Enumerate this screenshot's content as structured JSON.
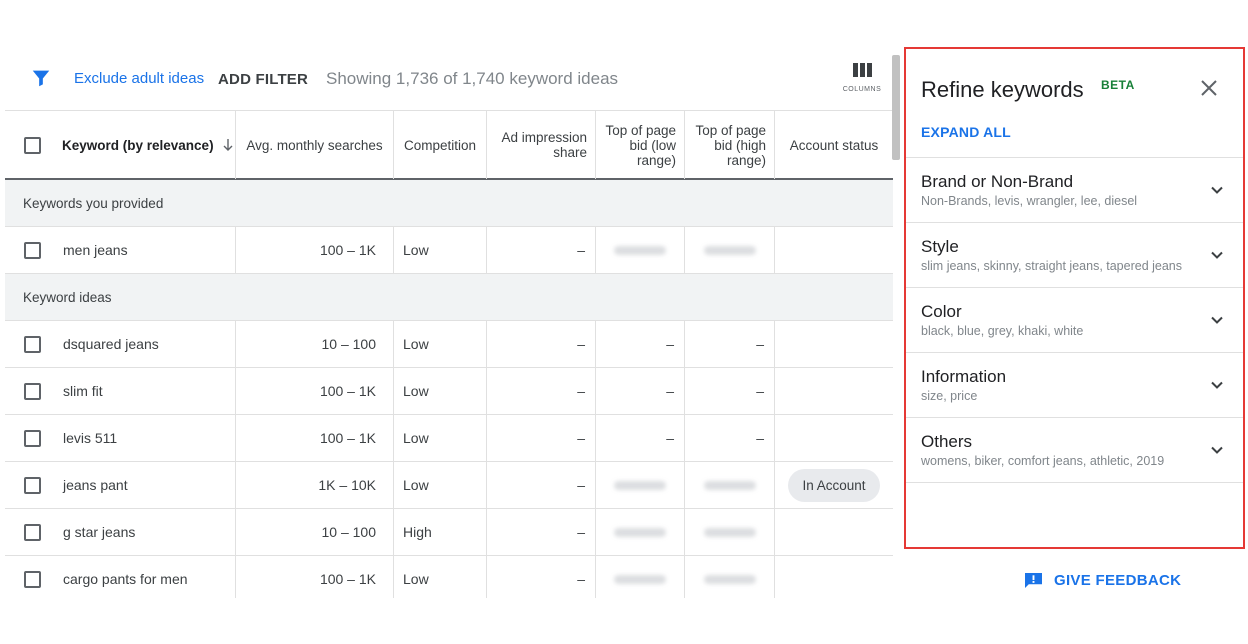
{
  "toolbar": {
    "exclude_label": "Exclude adult ideas",
    "add_filter_label": "ADD FILTER",
    "showing_text": "Showing 1,736 of 1,740 keyword ideas",
    "columns_label": "COLUMNS"
  },
  "table": {
    "headers": {
      "keyword": "Keyword (by relevance)",
      "searches": "Avg. monthly searches",
      "competition": "Competition",
      "impression": "Ad impression share",
      "bid_low": "Top of page bid (low range)",
      "bid_high": "Top of page bid (high range)",
      "status": "Account status"
    },
    "groups": {
      "provided": "Keywords you provided",
      "ideas": "Keyword ideas"
    },
    "provided_rows": [
      {
        "keyword": "men jeans",
        "searches": "100 – 1K",
        "competition": "Low",
        "impression": "–",
        "bid_low": "",
        "bid_high": "",
        "status": ""
      }
    ],
    "idea_rows": [
      {
        "keyword": "dsquared jeans",
        "searches": "10 – 100",
        "competition": "Low",
        "impression": "–",
        "bid_low": "–",
        "bid_high": "–",
        "status": ""
      },
      {
        "keyword": "slim fit",
        "searches": "100 – 1K",
        "competition": "Low",
        "impression": "–",
        "bid_low": "–",
        "bid_high": "–",
        "status": ""
      },
      {
        "keyword": "levis 511",
        "searches": "100 – 1K",
        "competition": "Low",
        "impression": "–",
        "bid_low": "–",
        "bid_high": "–",
        "status": ""
      },
      {
        "keyword": "jeans pant",
        "searches": "1K – 10K",
        "competition": "Low",
        "impression": "–",
        "bid_low": "",
        "bid_high": "",
        "status": "In Account"
      },
      {
        "keyword": "g star jeans",
        "searches": "10 – 100",
        "competition": "High",
        "impression": "–",
        "bid_low": "",
        "bid_high": "",
        "status": ""
      },
      {
        "keyword": "cargo pants for men",
        "searches": "100 – 1K",
        "competition": "Low",
        "impression": "–",
        "bid_low": "",
        "bid_high": "",
        "status": ""
      }
    ]
  },
  "refine": {
    "title": "Refine keywords",
    "beta": "BETA",
    "expand_all": "EXPAND ALL",
    "sections": [
      {
        "title": "Brand or Non-Brand",
        "subtitle": "Non-Brands, levis, wrangler, lee, diesel"
      },
      {
        "title": "Style",
        "subtitle": "slim jeans, skinny, straight jeans, tapered jeans"
      },
      {
        "title": "Color",
        "subtitle": "black, blue, grey, khaki, white"
      },
      {
        "title": "Information",
        "subtitle": "size, price"
      },
      {
        "title": "Others",
        "subtitle": "womens, biker, comfort jeans, athletic, 2019"
      }
    ]
  },
  "feedback": {
    "label": "GIVE FEEDBACK"
  },
  "colors": {
    "link_blue": "#1a73e8",
    "beta_green": "#188038",
    "highlight_red": "#e53935"
  },
  "icons": [
    "filter-icon",
    "columns-icon",
    "sort-arrow-down-icon",
    "close-icon",
    "chevron-down-icon",
    "feedback-icon"
  ]
}
